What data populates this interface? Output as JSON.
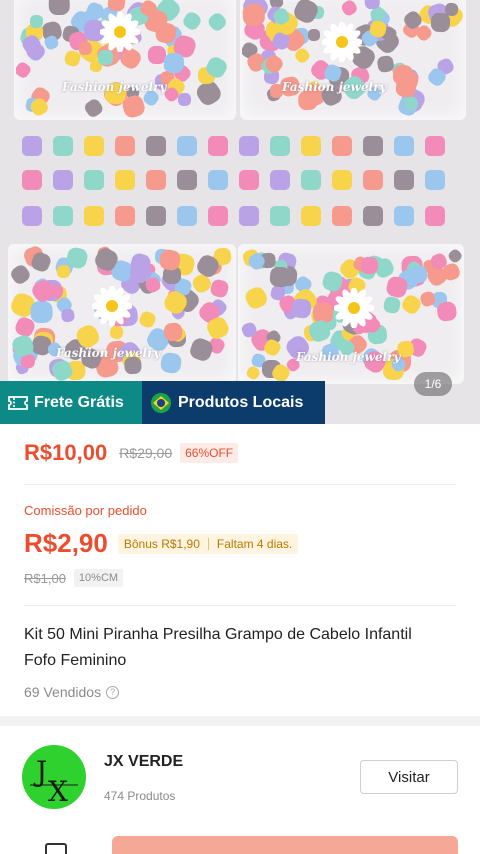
{
  "gallery": {
    "counter": "1/6",
    "brand_text": "Fashion jewelry",
    "colors": {
      "pink": "#f28bb8",
      "lilac": "#b9a3e6",
      "mint": "#8fd8c9",
      "yellow": "#f7d44c",
      "coral": "#f59a8c",
      "grey": "#9a8e98",
      "sky": "#9bc6ee"
    }
  },
  "badges": {
    "free_shipping": "Frete Grátis",
    "local_products": "Produtos Locais"
  },
  "price": {
    "current": "R$10,00",
    "original": "R$29,00",
    "discount": "66%OFF"
  },
  "commission": {
    "label": "Comissão por pedido",
    "amount": "R$2,90",
    "bonus": "Bônus R$1,90",
    "deadline": "Faltam 4 dias.",
    "old_amount": "R$1,00",
    "rate_tag": "10%CM"
  },
  "product": {
    "title": "Kit 50 Mini Piranha Presilha Grampo de Cabelo Infantil Fofo Feminino",
    "sold": "69 Vendidos"
  },
  "shop": {
    "name": "JX VERDE",
    "products": "474 Produtos",
    "visit_label": "Visitar",
    "accent": "#2ed12e"
  },
  "theme": {
    "accent": "#ee4d2d",
    "free_shipping_bg": "#0d8a85",
    "local_bg": "#0b3c6b"
  }
}
